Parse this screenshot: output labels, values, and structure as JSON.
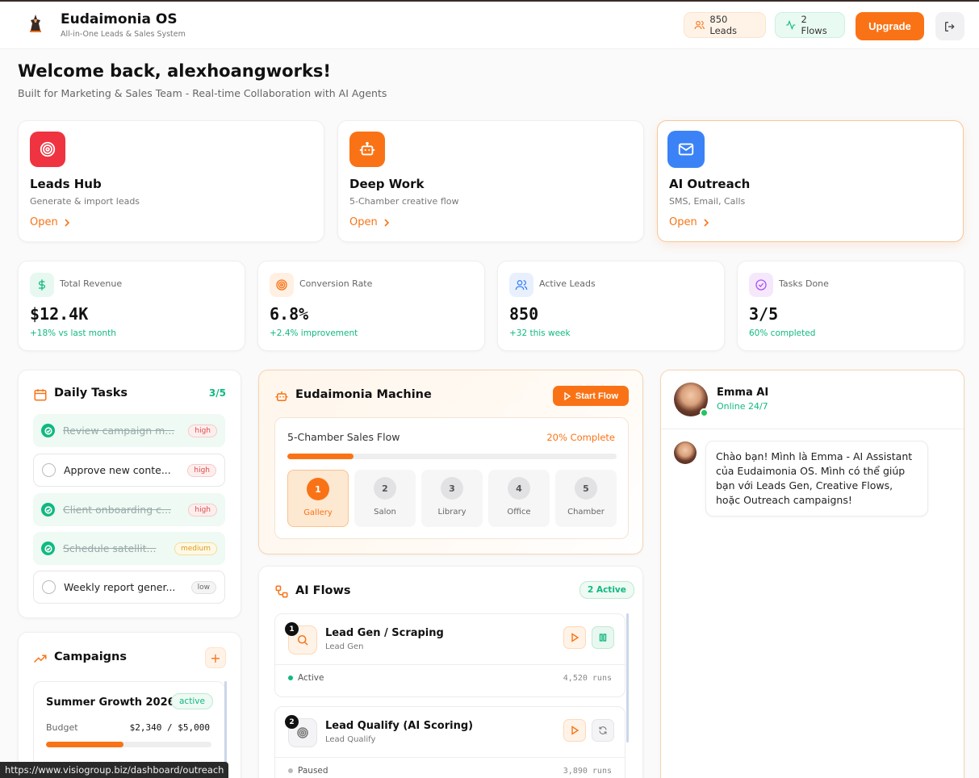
{
  "header": {
    "title": "Eudaimonia OS",
    "subtitle": "All-in-One Leads & Sales System",
    "leads_pill": "850 Leads",
    "flows_pill": "2 Flows",
    "upgrade_label": "Upgrade"
  },
  "welcome": {
    "title": "Welcome back, alexhoangworks!",
    "subtitle": "Built for Marketing & Sales Team - Real-time Collaboration with AI Agents"
  },
  "modules": [
    {
      "title": "Leads Hub",
      "subtitle": "Generate & import leads",
      "open": "Open",
      "icon": "target-icon",
      "color": "#ef3340"
    },
    {
      "title": "Deep Work",
      "subtitle": "5-Chamber creative flow",
      "open": "Open",
      "icon": "robot-icon",
      "color": "#f97316"
    },
    {
      "title": "AI Outreach",
      "subtitle": "SMS, Email, Calls",
      "open": "Open",
      "icon": "mail-icon",
      "color": "#3b82f6"
    }
  ],
  "stats": [
    {
      "label": "Total Revenue",
      "value": "$12.4K",
      "delta": "+18% vs last month",
      "icon": "dollar-icon"
    },
    {
      "label": "Conversion Rate",
      "value": "6.8%",
      "delta": "+2.4% improvement",
      "icon": "target-icon"
    },
    {
      "label": "Active Leads",
      "value": "850",
      "delta": "+32 this week",
      "icon": "users-icon"
    },
    {
      "label": "Tasks Done",
      "value": "3/5",
      "delta": "60% completed",
      "icon": "check-circle-icon"
    }
  ],
  "tasks": {
    "title": "Daily Tasks",
    "count": "3/5",
    "items": [
      {
        "text": "Review campaign m...",
        "priority": "high",
        "done": true
      },
      {
        "text": "Approve new conte...",
        "priority": "high",
        "done": false
      },
      {
        "text": "Client onboarding c...",
        "priority": "high",
        "done": true
      },
      {
        "text": "Schedule satellit...",
        "priority": "medium",
        "done": true
      },
      {
        "text": "Weekly report gener...",
        "priority": "low",
        "done": false
      }
    ]
  },
  "campaigns": {
    "title": "Campaigns",
    "add": "+",
    "items": [
      {
        "name": "Summer Growth 2026",
        "status": "active",
        "budget_label": "Budget",
        "budget_value": "$2,340 / $5,000",
        "budget_fraction": 0.468
      }
    ]
  },
  "machine": {
    "title": "Eudaimonia Machine",
    "start_label": "Start Flow",
    "flow_name": "5-Chamber Sales Flow",
    "progress_label": "20% Complete",
    "progress": 0.2,
    "chambers": [
      {
        "num": "1",
        "label": "Gallery",
        "active": true
      },
      {
        "num": "2",
        "label": "Salon",
        "active": false
      },
      {
        "num": "3",
        "label": "Library",
        "active": false
      },
      {
        "num": "4",
        "label": "Office",
        "active": false
      },
      {
        "num": "5",
        "label": "Chamber",
        "active": false
      }
    ]
  },
  "ai_flows": {
    "title": "AI Flows",
    "active_badge": "2 Active",
    "items": [
      {
        "num": "1",
        "name": "Lead Gen / Scraping",
        "category": "Lead Gen",
        "status": "Active",
        "runs": "4,520 runs",
        "status_color": "#10b981"
      },
      {
        "num": "2",
        "name": "Lead Qualify (AI Scoring)",
        "category": "Lead Qualify",
        "status": "Paused",
        "runs": "3,890 runs",
        "status_color": "#bbbbbb"
      }
    ]
  },
  "chat": {
    "name": "Emma AI",
    "status": "Online 24/7",
    "message": "Chào bạn! Mình là Emma - AI Assistant của Eudaimonia OS. Mình có thể giúp bạn với Leads Gen, Creative Flows, hoặc Outreach campaigns!"
  },
  "status_bar": {
    "url": "https://www.visiogroup.biz/dashboard/outreach"
  }
}
